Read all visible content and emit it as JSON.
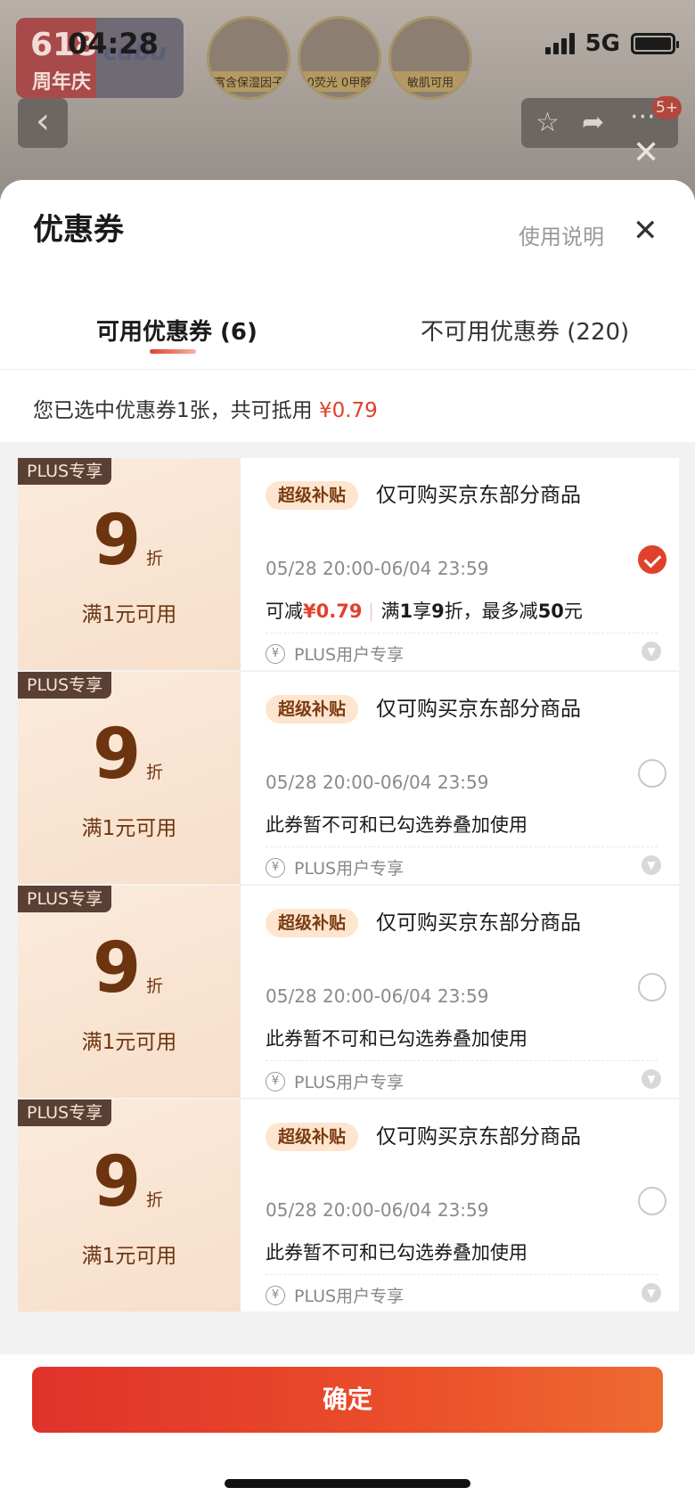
{
  "status_bar": {
    "time": "04:28",
    "network": "5G"
  },
  "background_page": {
    "promo_big": "618",
    "promo_small": "周年庆",
    "brand": "cubu",
    "features": [
      "富含保湿因子",
      "0荧光 0甲醛",
      "敏肌可用"
    ],
    "notification_count": "5+"
  },
  "sheet": {
    "title": "优惠券",
    "help_link": "使用说明",
    "tabs": [
      {
        "label": "可用优惠券 (6)",
        "active": true
      },
      {
        "label": "不可用优惠券 (220)",
        "active": false
      }
    ],
    "summary_prefix": "您已选中优惠券1张，共可抵用",
    "summary_amount": "¥0.79"
  },
  "coupons": [
    {
      "tag": "PLUS专享",
      "discount": "9",
      "unit": "折",
      "threshold": "满1元可用",
      "chip": "超级补贴",
      "scope": "仅可购买京东部分商品",
      "dates": "05/28 20:00-06/04 23:59",
      "checked": true,
      "save_label": "可减",
      "save_amount": "¥0.79",
      "rule_full": "满",
      "rule_full_val": "1",
      "rule_enjoy": "享",
      "rule_enjoy_val": "9",
      "rule_discount": "折，最多减",
      "rule_max_val": "50",
      "rule_yuan": "元",
      "footer": "PLUS用户专享"
    },
    {
      "tag": "PLUS专享",
      "discount": "9",
      "unit": "折",
      "threshold": "满1元可用",
      "chip": "超级补贴",
      "scope": "仅可购买京东部分商品",
      "dates": "05/28 20:00-06/04 23:59",
      "checked": false,
      "note": "此券暂不可和已勾选券叠加使用",
      "footer": "PLUS用户专享"
    },
    {
      "tag": "PLUS专享",
      "discount": "9",
      "unit": "折",
      "threshold": "满1元可用",
      "chip": "超级补贴",
      "scope": "仅可购买京东部分商品",
      "dates": "05/28 20:00-06/04 23:59",
      "checked": false,
      "note": "此券暂不可和已勾选券叠加使用",
      "footer": "PLUS用户专享"
    },
    {
      "tag": "PLUS专享",
      "discount": "9",
      "unit": "折",
      "threshold": "满1元可用",
      "chip": "超级补贴",
      "scope": "仅可购买京东部分商品",
      "dates": "05/28 20:00-06/04 23:59",
      "checked": false,
      "note": "此券暂不可和已勾选券叠加使用",
      "footer": "PLUS用户专享"
    }
  ],
  "footer_button": {
    "label": "确定"
  },
  "icons": {
    "back": "chevron-left-icon",
    "favorite": "star-icon",
    "share": "share-icon",
    "more": "more-icon",
    "close": "close-icon",
    "currency": "yen-icon",
    "expand": "chevron-down-icon",
    "selected": "check-icon"
  },
  "colors": {
    "accent": "#e0412d",
    "coupon_text": "#6d3410",
    "plus_tag": "#5a4034",
    "chip_bg": "#fde5cf"
  }
}
